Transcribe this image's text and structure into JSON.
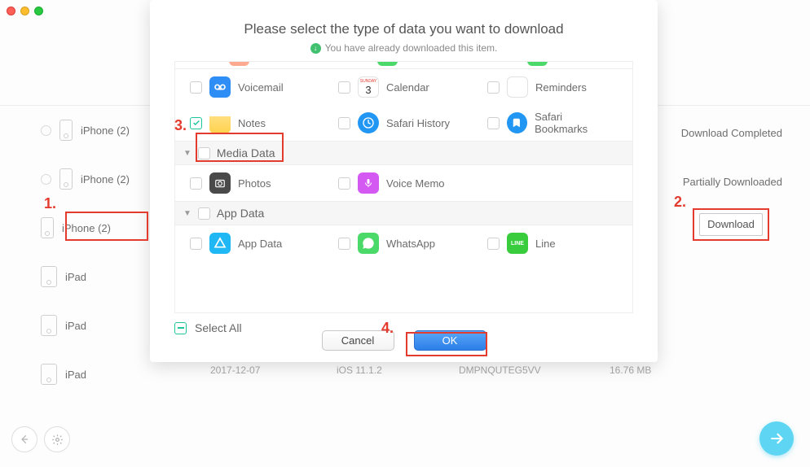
{
  "sidebar": {
    "devices": [
      {
        "label": "iPhone (2)"
      },
      {
        "label": "iPhone (2)"
      },
      {
        "label": "iPhone (2)"
      },
      {
        "label": "iPad"
      },
      {
        "label": "iPad"
      },
      {
        "label": "iPad"
      }
    ]
  },
  "status": {
    "completed": "Download Completed",
    "partial": "Partially Downloaded",
    "download_btn": "Download"
  },
  "steps": {
    "1": "1.",
    "2": "2.",
    "3": "3.",
    "4": "4."
  },
  "bg_row": {
    "date": "2017-12-07",
    "os": "iOS 11.1.2",
    "serial": "DMPNQUTEG5VV",
    "size": "16.76 MB"
  },
  "modal": {
    "title": "Please select the type of data you want to download",
    "subtitle": "You have already downloaded this item.",
    "sections": {
      "media": "Media Data",
      "app": "App Data"
    },
    "items": {
      "voicemail": "Voicemail",
      "calendar": "Calendar",
      "reminders": "Reminders",
      "notes": "Notes",
      "safari_history": "Safari History",
      "safari_bookmarks": "Safari Bookmarks",
      "photos": "Photos",
      "voice_memo": "Voice Memo",
      "app_data": "App Data",
      "whatsapp": "WhatsApp",
      "line": "Line"
    },
    "select_all": "Select All",
    "cancel": "Cancel",
    "ok": "OK"
  }
}
